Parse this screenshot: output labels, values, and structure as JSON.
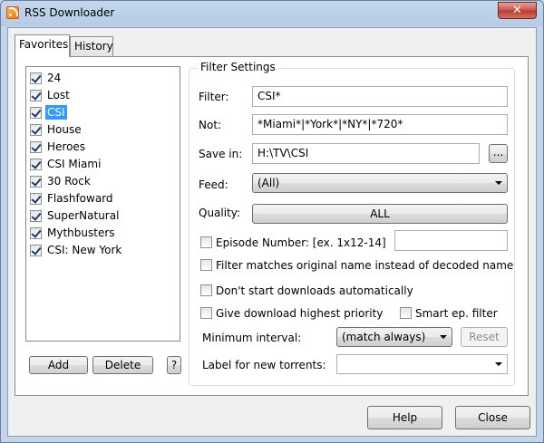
{
  "window": {
    "title": "RSS Downloader",
    "close_glyph": "✕"
  },
  "tabs": [
    {
      "label": "Favorites",
      "active": true
    },
    {
      "label": "History",
      "active": false
    }
  ],
  "favorites": {
    "items": [
      {
        "label": "24",
        "checked": true
      },
      {
        "label": "Lost",
        "checked": true
      },
      {
        "label": "CSI",
        "checked": true,
        "selected": true
      },
      {
        "label": "House",
        "checked": true
      },
      {
        "label": "Heroes",
        "checked": true
      },
      {
        "label": "CSI Miami",
        "checked": true
      },
      {
        "label": "30 Rock",
        "checked": true
      },
      {
        "label": "Flashfoward",
        "checked": true
      },
      {
        "label": "SuperNatural",
        "checked": true
      },
      {
        "label": "Mythbusters",
        "checked": true
      },
      {
        "label": "CSI: New York",
        "checked": true
      }
    ],
    "add_label": "Add",
    "delete_label": "Delete",
    "help_label": "?"
  },
  "filter": {
    "group_title": "Filter Settings",
    "filter_label": "Filter:",
    "filter_value": "CSI*",
    "not_label": "Not:",
    "not_value": "*Miami*|*York*|*NY*|*720*",
    "save_label": "Save in:",
    "save_value": "H:\\TV\\CSI",
    "browse_label": "...",
    "feed_label": "Feed:",
    "feed_value": "(All)",
    "quality_label": "Quality:",
    "quality_value": "ALL",
    "episode_label": "Episode Number: [ex. 1x12-14]",
    "episode_checked": false,
    "episode_value": "",
    "original_name_label": "Filter matches original name instead of decoded name",
    "original_name_checked": false,
    "no_auto_label": "Don't start downloads automatically",
    "no_auto_checked": false,
    "priority_label": "Give download highest priority",
    "priority_checked": false,
    "smart_label": "Smart ep. filter",
    "smart_checked": false,
    "interval_label": "Minimum interval:",
    "interval_value": "(match always)",
    "reset_label": "Reset",
    "torrent_label": "Label for new torrents:",
    "torrent_value": ""
  },
  "footer": {
    "help_label": "Help",
    "close_label": "Close"
  }
}
